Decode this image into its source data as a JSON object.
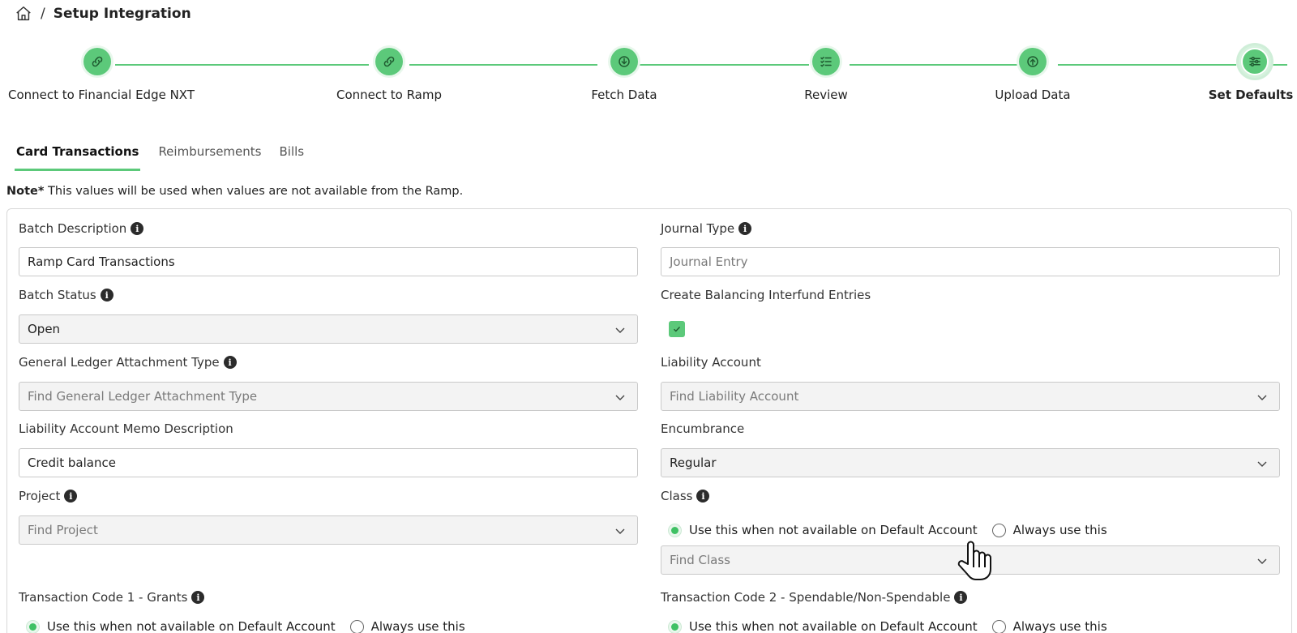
{
  "breadcrumb": {
    "separator": "/",
    "title": "Setup Integration"
  },
  "steps": [
    {
      "label": "Connect to Financial Edge NXT",
      "icon": "link-icon"
    },
    {
      "label": "Connect to Ramp",
      "icon": "link-icon"
    },
    {
      "label": "Fetch Data",
      "icon": "download-icon"
    },
    {
      "label": "Review",
      "icon": "checklist-icon"
    },
    {
      "label": "Upload Data",
      "icon": "upload-icon"
    },
    {
      "label": "Set Defaults",
      "icon": "sliders-icon",
      "active": true
    }
  ],
  "tabs": [
    {
      "label": "Card Transactions",
      "active": true
    },
    {
      "label": "Reimbursements"
    },
    {
      "label": "Bills"
    }
  ],
  "note": {
    "prefix": "Note*",
    "text": " This values will be used when values are not available from the Ramp."
  },
  "form": {
    "batch_description": {
      "label": "Batch Description",
      "value": "Ramp Card Transactions"
    },
    "journal_type": {
      "label": "Journal Type",
      "placeholder": "Journal Entry"
    },
    "batch_status": {
      "label": "Batch Status",
      "value": "Open"
    },
    "create_balancing": {
      "label": "Create Balancing Interfund Entries",
      "checked": true
    },
    "gl_attachment_type": {
      "label": "General Ledger Attachment Type",
      "placeholder": "Find General Ledger Attachment Type"
    },
    "liability_account": {
      "label": "Liability Account",
      "placeholder": "Find Liability Account"
    },
    "liability_memo": {
      "label": "Liability Account Memo Description",
      "value": "Credit balance"
    },
    "encumbrance": {
      "label": "Encumbrance",
      "value": "Regular"
    },
    "project": {
      "label": "Project",
      "placeholder": "Find Project"
    },
    "class": {
      "label": "Class",
      "option_default": "Use this when not available on Default Account",
      "option_always": "Always use this",
      "placeholder": "Find Class"
    },
    "transaction_code_1": {
      "label": "Transaction Code 1 - Grants",
      "option_default": "Use this when not available on Default Account",
      "option_always": "Always use this"
    },
    "transaction_code_2": {
      "label": "Transaction Code 2 - Spendable/Non-Spendable",
      "option_default": "Use this when not available on Default Account",
      "option_always": "Always use this"
    }
  },
  "colors": {
    "accent": "#5cc97a",
    "accent_light": "#e8f7ec",
    "border": "#c9c9c9"
  }
}
